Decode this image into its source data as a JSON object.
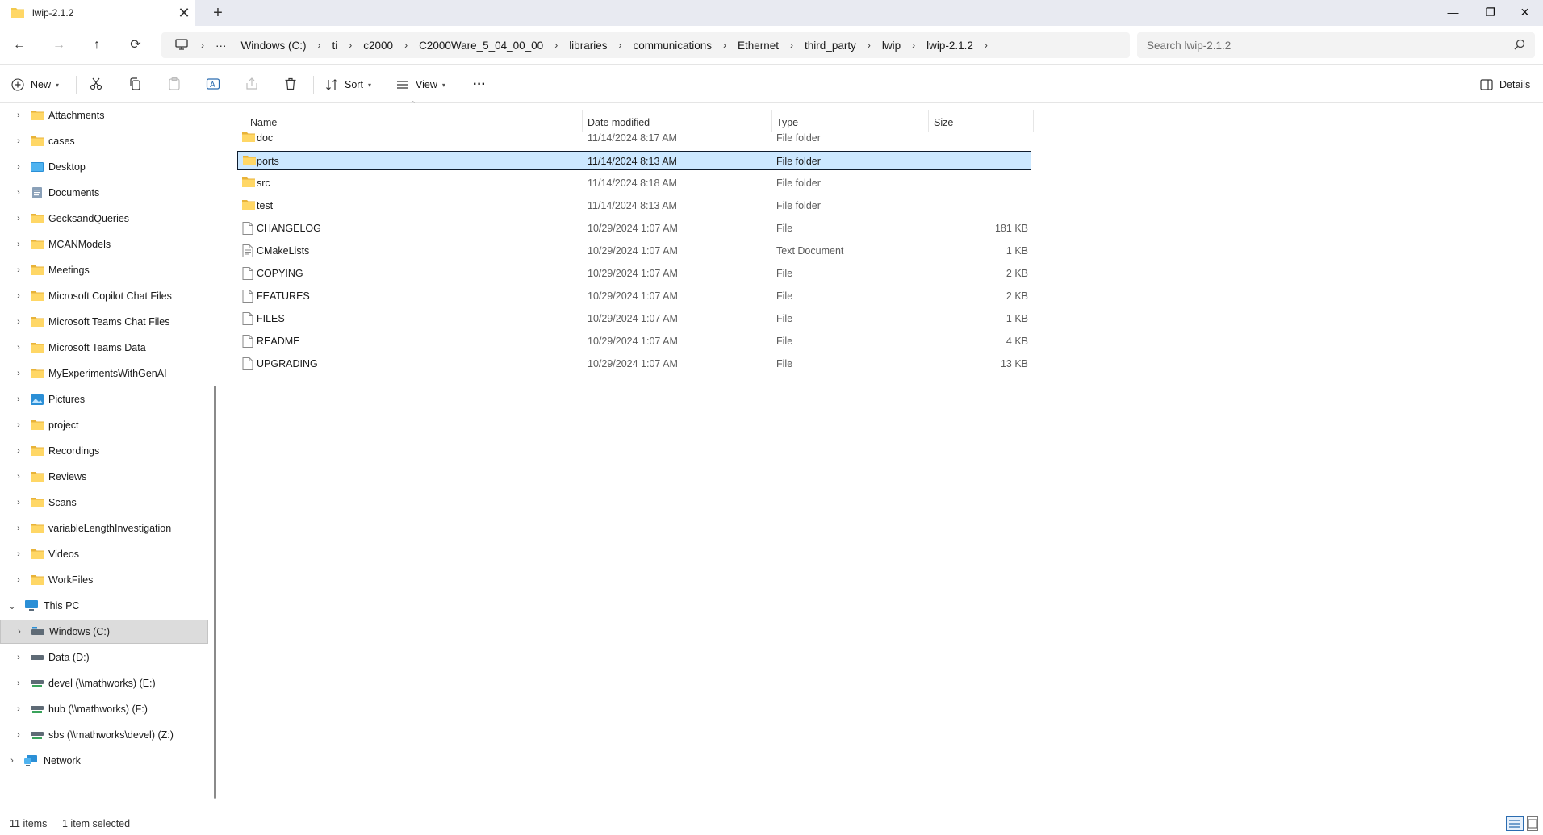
{
  "tab": {
    "title": "lwip-2.1.2",
    "close": "✕",
    "new": "+"
  },
  "window_controls": {
    "minimize": "—",
    "maximize": "❐",
    "close": "✕"
  },
  "nav": {
    "back": "←",
    "forward": "→",
    "up": "↑",
    "refresh": "⟳"
  },
  "breadcrumb": {
    "more": "···",
    "items": [
      "Windows (C:)",
      "ti",
      "c2000",
      "C2000Ware_5_04_00_00",
      "libraries",
      "communications",
      "Ethernet",
      "third_party",
      "lwip",
      "lwip-2.1.2"
    ]
  },
  "search": {
    "placeholder": "Search lwip-2.1.2"
  },
  "toolbar": {
    "new_label": "New",
    "sort_label": "Sort",
    "view_label": "View",
    "more_label": "···",
    "details_label": "Details"
  },
  "sidebar": {
    "items": [
      {
        "label": "Attachments",
        "icon": "folder-icon"
      },
      {
        "label": "cases",
        "icon": "folder-icon"
      },
      {
        "label": "Desktop",
        "icon": "desktop-icon"
      },
      {
        "label": "Documents",
        "icon": "documents-icon"
      },
      {
        "label": "GecksandQueries",
        "icon": "folder-icon"
      },
      {
        "label": "MCANModels",
        "icon": "folder-icon"
      },
      {
        "label": "Meetings",
        "icon": "folder-icon"
      },
      {
        "label": "Microsoft Copilot Chat Files",
        "icon": "folder-icon"
      },
      {
        "label": "Microsoft Teams Chat Files",
        "icon": "folder-icon"
      },
      {
        "label": "Microsoft Teams Data",
        "icon": "folder-icon"
      },
      {
        "label": "MyExperimentsWithGenAI",
        "icon": "folder-icon"
      },
      {
        "label": "Pictures",
        "icon": "pictures-icon"
      },
      {
        "label": "project",
        "icon": "folder-icon"
      },
      {
        "label": "Recordings",
        "icon": "folder-icon"
      },
      {
        "label": "Reviews",
        "icon": "folder-icon"
      },
      {
        "label": "Scans",
        "icon": "folder-icon"
      },
      {
        "label": "variableLengthInvestigation",
        "icon": "folder-icon"
      },
      {
        "label": "Videos",
        "icon": "folder-icon"
      },
      {
        "label": "WorkFiles",
        "icon": "folder-icon"
      }
    ],
    "this_pc": "This PC",
    "drives": [
      {
        "label": "Windows (C:)",
        "icon": "windows-drive-icon"
      },
      {
        "label": "Data (D:)",
        "icon": "drive-icon"
      },
      {
        "label": "devel (\\\\mathworks) (E:)",
        "icon": "network-drive-icon"
      },
      {
        "label": "hub (\\\\mathworks) (F:)",
        "icon": "network-drive-icon"
      },
      {
        "label": "sbs (\\\\mathworks\\devel) (Z:)",
        "icon": "network-drive-icon"
      }
    ],
    "network": "Network"
  },
  "columns": {
    "name": "Name",
    "date": "Date modified",
    "type": "Type",
    "size": "Size"
  },
  "files": [
    {
      "name": "doc",
      "date": "11/14/2024 8:17 AM",
      "type": "File folder",
      "size": "",
      "icon": "folder-icon"
    },
    {
      "name": "ports",
      "date": "11/14/2024 8:13 AM",
      "type": "File folder",
      "size": "",
      "icon": "folder-icon"
    },
    {
      "name": "src",
      "date": "11/14/2024 8:18 AM",
      "type": "File folder",
      "size": "",
      "icon": "folder-icon"
    },
    {
      "name": "test",
      "date": "11/14/2024 8:13 AM",
      "type": "File folder",
      "size": "",
      "icon": "folder-icon"
    },
    {
      "name": "CHANGELOG",
      "date": "10/29/2024 1:07 AM",
      "type": "File",
      "size": "181 KB",
      "icon": "file-icon"
    },
    {
      "name": "CMakeLists",
      "date": "10/29/2024 1:07 AM",
      "type": "Text Document",
      "size": "1 KB",
      "icon": "text-file-icon"
    },
    {
      "name": "COPYING",
      "date": "10/29/2024 1:07 AM",
      "type": "File",
      "size": "2 KB",
      "icon": "file-icon"
    },
    {
      "name": "FEATURES",
      "date": "10/29/2024 1:07 AM",
      "type": "File",
      "size": "2 KB",
      "icon": "file-icon"
    },
    {
      "name": "FILES",
      "date": "10/29/2024 1:07 AM",
      "type": "File",
      "size": "1 KB",
      "icon": "file-icon"
    },
    {
      "name": "README",
      "date": "10/29/2024 1:07 AM",
      "type": "File",
      "size": "4 KB",
      "icon": "file-icon"
    },
    {
      "name": "UPGRADING",
      "date": "10/29/2024 1:07 AM",
      "type": "File",
      "size": "13 KB",
      "icon": "file-icon"
    }
  ],
  "status": {
    "count": "11 items",
    "selection": "1 item selected"
  },
  "colors": {
    "folder": "#f2c94c",
    "selection": "#cce8ff",
    "accent": "#0067c0"
  }
}
